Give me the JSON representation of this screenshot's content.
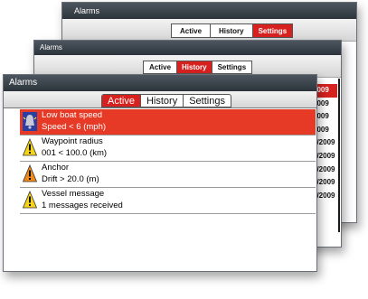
{
  "colors": {
    "accent_red": "#d6211f",
    "selected_row": "#e63a26",
    "titlebar_dark": "#2c333b"
  },
  "tabs": {
    "active": "Active",
    "history": "History",
    "settings": "Settings"
  },
  "settings_window": {
    "title": "Alarms"
  },
  "history_window": {
    "title": "Alarms",
    "dates": [
      "2009",
      "2009",
      "2009",
      "2009",
      "2/2009",
      "2/2009",
      "2/2009",
      "2/2009",
      "2/2009"
    ],
    "selected_index": 0
  },
  "active_window": {
    "title": "Alarms",
    "alarms": [
      {
        "name": "Low boat speed",
        "detail": "Speed < 6 (mph)",
        "icon": "alarm-bell-icon",
        "selected": true
      },
      {
        "name": "Waypoint radius",
        "detail": "001 < 100.0 (km)",
        "icon": "warning-triangle-yellow-icon",
        "selected": false
      },
      {
        "name": "Anchor",
        "detail": "Drift > 20.0 (m)",
        "icon": "warning-triangle-orange-icon",
        "selected": false
      },
      {
        "name": "Vessel message",
        "detail": "1 messages received",
        "icon": "warning-triangle-yellow-icon",
        "selected": false
      }
    ]
  }
}
